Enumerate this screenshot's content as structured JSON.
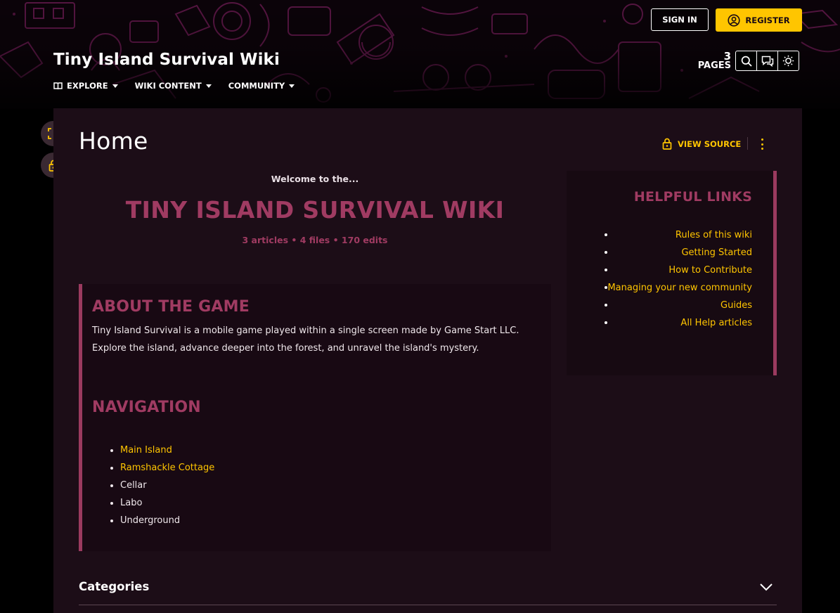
{
  "header": {
    "wiki_title": "Tiny Island Survival Wiki",
    "nav": [
      {
        "label": "EXPLORE",
        "icon": "book-icon"
      },
      {
        "label": "WIKI CONTENT"
      },
      {
        "label": "COMMUNITY"
      }
    ],
    "sign_in_label": "SIGN IN",
    "register_label": "REGISTER",
    "pages_count": "3",
    "pages_label": "PAGES",
    "tools": [
      "search-icon",
      "discussion-icon",
      "theme-toggle-icon"
    ]
  },
  "page": {
    "title": "Home",
    "view_source_label": "VIEW SOURCE",
    "welcome": "Welcome to the...",
    "main_title": "TINY ISLAND SURVIVAL WIKI",
    "stats": "3 articles • 4 files • 170 edits",
    "about_heading": "ABOUT THE GAME",
    "about_line1": "Tiny Island Survival is a mobile game played within a single screen made by Game Start LLC.",
    "about_line2": "Explore the island, advance deeper into the forest, and unravel the island's mystery.",
    "navigation_heading": "NAVIGATION",
    "navigation_items": [
      {
        "label": "Main Island",
        "link": true
      },
      {
        "label": "Ramshackle Cottage",
        "link": true
      },
      {
        "label": "Cellar",
        "link": false
      },
      {
        "label": "Labo",
        "link": false
      },
      {
        "label": "Underground",
        "link": false
      }
    ],
    "helpful_heading": "HELPFUL LINKS",
    "helpful_links": [
      "Rules of this wiki",
      "Getting Started",
      "How to Contribute",
      "Managing your new community",
      "Guides",
      "All Help articles"
    ],
    "categories_label": "Categories"
  },
  "colors": {
    "accent": "#ffc500",
    "heading": "#a03b62",
    "background": "#1c0d17"
  }
}
